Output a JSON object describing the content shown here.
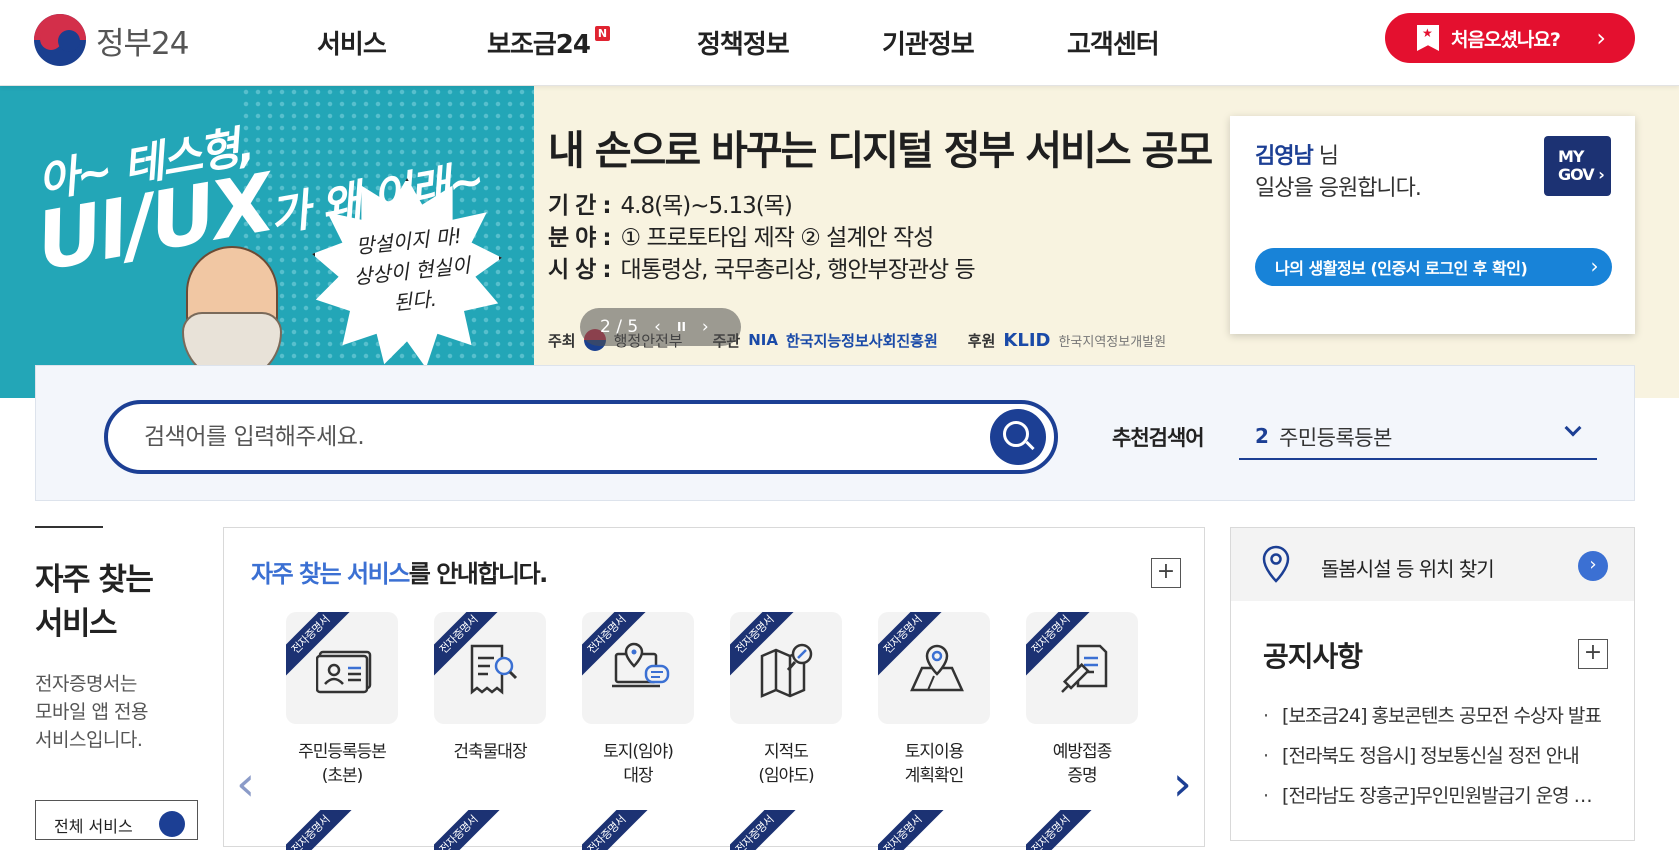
{
  "header": {
    "logo_text": "정부24",
    "nav": [
      {
        "label": "서비스"
      },
      {
        "label": "보조금24",
        "badge": "N"
      },
      {
        "label": "정책정보"
      },
      {
        "label": "기관정보"
      },
      {
        "label": "고객센터"
      }
    ],
    "first_visit_label": "처음오셨나요?"
  },
  "banner": {
    "left_line1": "아~ 테스형,",
    "left_line2": "UI/UX",
    "left_line3": "가 왜 이래~",
    "burst_text": "망설이지 마! 상상이 현실이 된다.",
    "title": "내 손으로 바꾸는 디지털 정부 서비스 공모",
    "period_label": "기 간 :",
    "period_value": "4.8(목)~5.13(목)",
    "field_label": "분 야 :",
    "field_value": "① 프로토타입 제작 ② 설계안 작성",
    "award_label": "시 상 :",
    "award_value": "대통령상, 국무총리상, 행안부장관상 등",
    "host_label": "주최",
    "host_value": "행정안전부",
    "organizer_label": "주관",
    "organizer_logo": "NIA",
    "organizer_name": "한국지능정보사회진흥원",
    "sponsor_label": "후원",
    "sponsor_logo": "KLID",
    "sponsor_name": "한국지역정보개발원",
    "slide_counter": "2 / 5",
    "prev_icon": "‹",
    "pause_icon": "II",
    "next_icon": "›"
  },
  "my_card": {
    "user_name": "김영남",
    "honorific": "님",
    "subtitle": "일상을 응원합니다.",
    "mygov_line1": "MY",
    "mygov_line2": "GOV",
    "life_info_button": "나의 생활정보 (인증서 로그인 후 확인)"
  },
  "search": {
    "placeholder": "검색어를 입력해주세요.",
    "recommend_label": "추천검색어",
    "recommend_rank": "2",
    "recommend_term": "주민등록등본"
  },
  "frequent": {
    "title_line1": "자주 찾는",
    "title_line2": "서비스",
    "desc_line1": "전자증명서는",
    "desc_line2": "모바일 앱 전용",
    "desc_line3": "서비스입니다.",
    "all_button": "전체 서비스"
  },
  "services_panel": {
    "heading_highlight": "자주 찾는 서비스",
    "heading_rest": "를 안내합니다.",
    "plus": "+",
    "ribbon": "전자증명서",
    "items": [
      {
        "line1": "주민등록등본",
        "line2": "(초본)",
        "icon": "id-card-icon"
      },
      {
        "line1": "건축물대장",
        "line2": "",
        "icon": "document-search-icon"
      },
      {
        "line1": "토지(임야)",
        "line2": "대장",
        "icon": "land-location-icon"
      },
      {
        "line1": "지적도",
        "line2": "(임야도)",
        "icon": "map-search-icon"
      },
      {
        "line1": "토지이용",
        "line2": "계획확인",
        "icon": "map-pin-icon"
      },
      {
        "line1": "예방접종",
        "line2": "증명",
        "icon": "syringe-icon"
      }
    ]
  },
  "location": {
    "label": "돌봄시설 등 위치 찾기"
  },
  "notice": {
    "title": "공지사항",
    "plus": "+",
    "items": [
      "[보조금24] 홍보콘텐츠 공모전 수상자 발표",
      "[전라북도 정읍시] 정보통신실 정전 안내",
      "[전라남도 장흥군]무인민원발급기 운영 중지 안내"
    ]
  },
  "colors": {
    "brand_navy": "#1c3f94",
    "accent_red": "#e4102f",
    "banner_teal": "#23a6b7",
    "banner_cream": "#f8f3e0",
    "highlight_blue": "#3b70d3"
  }
}
